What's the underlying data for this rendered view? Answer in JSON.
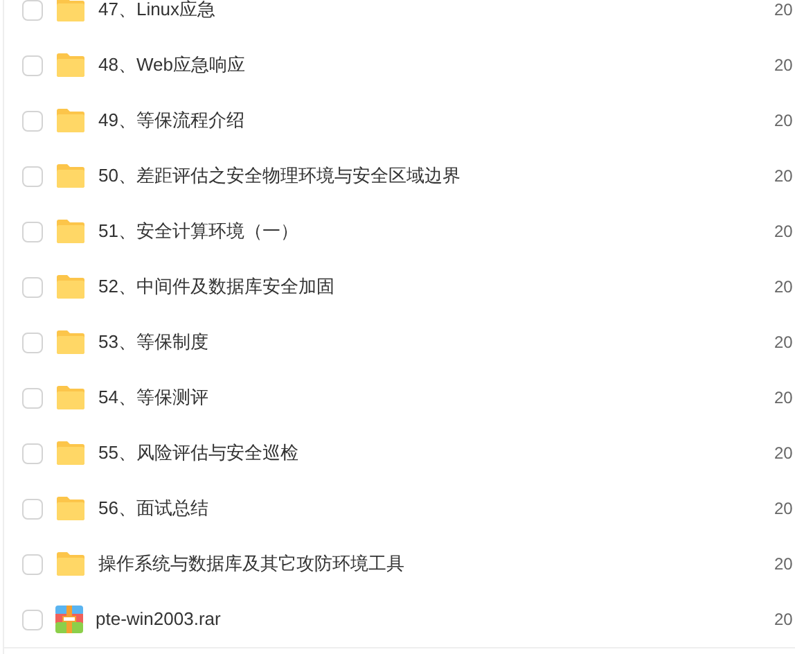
{
  "files": [
    {
      "kind": "folder",
      "name": "47、Linux应急",
      "checked": false,
      "date": "20"
    },
    {
      "kind": "folder",
      "name": "48、Web应急响应",
      "checked": false,
      "date": "20"
    },
    {
      "kind": "folder",
      "name": "49、等保流程介绍",
      "checked": false,
      "date": "20"
    },
    {
      "kind": "folder",
      "name": "50、差距评估之安全物理环境与安全区域边界",
      "checked": false,
      "date": "20"
    },
    {
      "kind": "folder",
      "name": "51、安全计算环境（一）",
      "checked": false,
      "date": "20"
    },
    {
      "kind": "folder",
      "name": "52、中间件及数据库安全加固",
      "checked": false,
      "date": "20"
    },
    {
      "kind": "folder",
      "name": "53、等保制度",
      "checked": false,
      "date": "20"
    },
    {
      "kind": "folder",
      "name": "54、等保测评",
      "checked": false,
      "date": "20"
    },
    {
      "kind": "folder",
      "name": "55、风险评估与安全巡检",
      "checked": false,
      "date": "20"
    },
    {
      "kind": "folder",
      "name": "56、面试总结",
      "checked": false,
      "date": "20"
    },
    {
      "kind": "folder",
      "name": "操作系统与数据库及其它攻防环境工具",
      "checked": false,
      "date": "20"
    },
    {
      "kind": "archive",
      "name": "pte-win2003.rar",
      "checked": false,
      "date": "20"
    }
  ]
}
